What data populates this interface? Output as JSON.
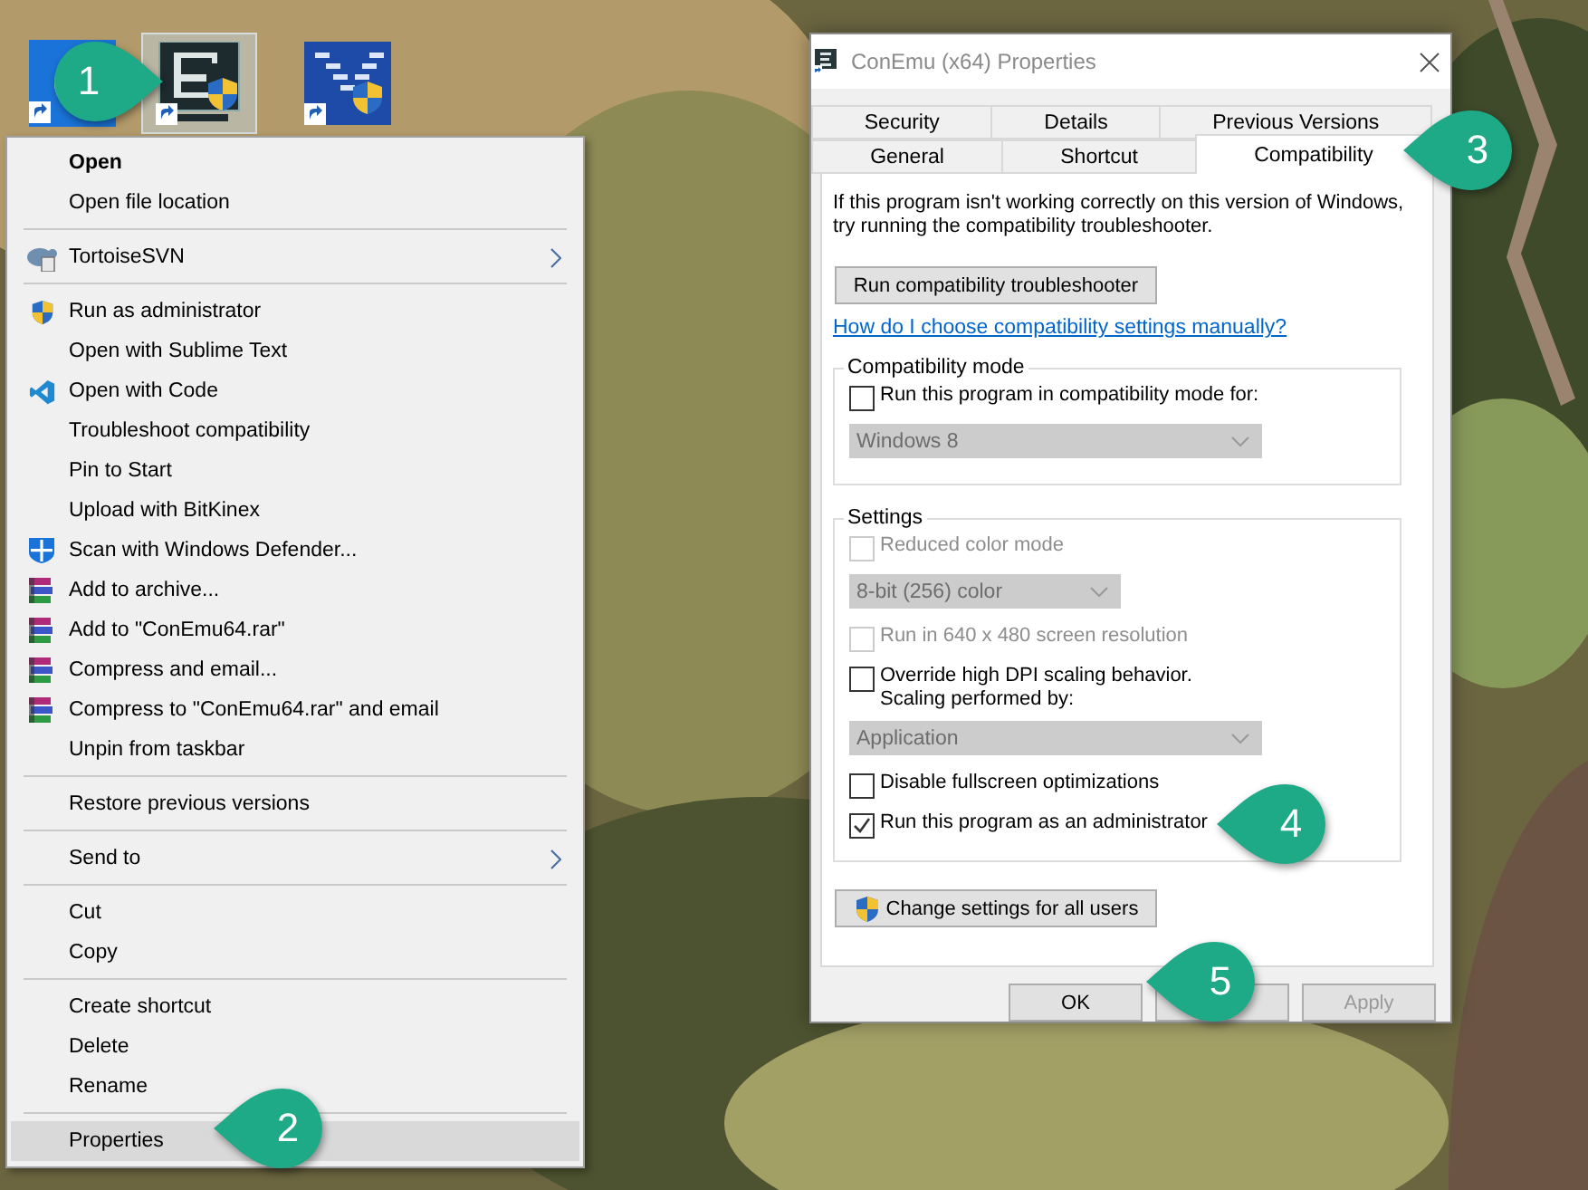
{
  "desktop_icons": [
    {
      "kind": "circle",
      "selected": false
    },
    {
      "kind": "terminal",
      "selected": true
    },
    {
      "kind": "chevron",
      "selected": false
    }
  ],
  "context_menu": {
    "groups": [
      [
        {
          "label": "Open",
          "default": true,
          "submenu": false,
          "selected": false
        },
        {
          "label": "Open file location",
          "default": false,
          "submenu": false,
          "selected": false
        }
      ],
      [
        {
          "label": "TortoiseSVN",
          "kind": "turtle",
          "default": false,
          "submenu": true,
          "selected": false
        }
      ],
      [
        {
          "label": "Run as administrator",
          "kind": "shield",
          "default": false,
          "submenu": false,
          "selected": false
        },
        {
          "label": "Open with Sublime Text",
          "default": false,
          "submenu": false,
          "selected": false
        },
        {
          "label": "Open with Code",
          "kind": "code",
          "default": false,
          "submenu": false,
          "selected": false
        },
        {
          "label": "Troubleshoot compatibility",
          "default": false,
          "submenu": false,
          "selected": false
        },
        {
          "label": "Pin to Start",
          "default": false,
          "submenu": false,
          "selected": false
        },
        {
          "label": "Upload with BitKinex",
          "default": false,
          "submenu": false,
          "selected": false
        },
        {
          "label": "Scan with Windows Defender...",
          "kind": "defender",
          "default": false,
          "submenu": false,
          "selected": false
        },
        {
          "label": "Add to archive...",
          "kind": "archive",
          "default": false,
          "submenu": false,
          "selected": false
        },
        {
          "label": "Add to \"ConEmu64.rar\"",
          "kind": "archive",
          "default": false,
          "submenu": false,
          "selected": false
        },
        {
          "label": "Compress and email...",
          "kind": "archive",
          "default": false,
          "submenu": false,
          "selected": false
        },
        {
          "label": "Compress to \"ConEmu64.rar\" and email",
          "kind": "archive",
          "default": false,
          "submenu": false,
          "selected": false
        },
        {
          "label": "Unpin from taskbar",
          "default": false,
          "submenu": false,
          "selected": false
        }
      ],
      [
        {
          "label": "Restore previous versions",
          "default": false,
          "submenu": false,
          "selected": false
        }
      ],
      [
        {
          "label": "Send to",
          "default": false,
          "submenu": true,
          "selected": false
        }
      ],
      [
        {
          "label": "Cut",
          "default": false,
          "submenu": false,
          "selected": false
        },
        {
          "label": "Copy",
          "default": false,
          "submenu": false,
          "selected": false
        }
      ],
      [
        {
          "label": "Create shortcut",
          "default": false,
          "submenu": false,
          "selected": false
        },
        {
          "label": "Delete",
          "default": false,
          "submenu": false,
          "selected": false
        },
        {
          "label": "Rename",
          "default": false,
          "submenu": false,
          "selected": false
        }
      ],
      [
        {
          "label": "Properties",
          "default": false,
          "submenu": false,
          "selected": true
        }
      ]
    ]
  },
  "dialog": {
    "title": "ConEmu (x64) Properties",
    "tab_rows": [
      [
        {
          "label": "Security",
          "selected": false
        },
        {
          "label": "Details",
          "selected": false
        },
        {
          "label": "Previous Versions",
          "selected": false
        }
      ],
      [
        {
          "label": "General",
          "selected": false
        },
        {
          "label": "Shortcut",
          "selected": false
        },
        {
          "label": "Compatibility",
          "selected": true
        }
      ]
    ],
    "intro": "If this program isn't working correctly on this version of Windows, try running the compatibility troubleshooter.",
    "troubleshoot_button": "Run compatibility troubleshooter",
    "help_link": "How do I choose compatibility settings manually?",
    "groups": [
      {
        "title": "Compatibility mode",
        "items": [
          {
            "kind": "checkbox",
            "label": "Run this program in compatibility mode for:",
            "checked": false,
            "disabled": false
          },
          {
            "kind": "dropdown",
            "value": "Windows 8",
            "disabled": true
          }
        ]
      },
      {
        "title": "Settings",
        "items": [
          {
            "kind": "checkbox",
            "label": "Reduced color mode",
            "checked": false,
            "disabled": true
          },
          {
            "kind": "dropdown",
            "value": "8-bit (256) color",
            "disabled": true
          },
          {
            "kind": "checkbox",
            "label": "Run in 640 x 480 screen resolution",
            "checked": false,
            "disabled": true
          },
          {
            "kind": "checkbox",
            "label": "Override high DPI scaling behavior.\nScaling performed by:",
            "checked": false,
            "disabled": false
          },
          {
            "kind": "dropdown",
            "value": "Application",
            "disabled": true
          },
          {
            "kind": "checkbox",
            "label": "Disable fullscreen optimizations",
            "checked": false,
            "disabled": false
          },
          {
            "kind": "checkbox",
            "label": "Run this program as an administrator",
            "checked": true,
            "disabled": false
          }
        ]
      }
    ],
    "all_users_button": "Change settings for all users",
    "buttons": [
      {
        "label": "OK",
        "disabled": false
      },
      {
        "label": "Apply",
        "disabled": true
      }
    ]
  },
  "callouts": [
    {
      "number": "1"
    },
    {
      "number": "2"
    },
    {
      "number": "3"
    },
    {
      "number": "4"
    },
    {
      "number": "5"
    }
  ]
}
